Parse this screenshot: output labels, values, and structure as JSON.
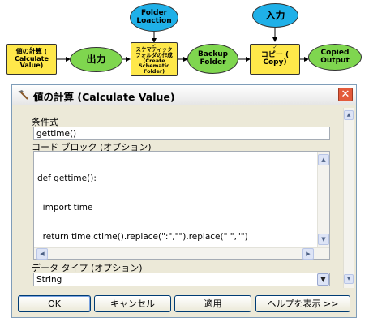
{
  "model": {
    "nodes": {
      "calculate_value": "値の計算 (\nCalculate\nValue)",
      "output": "出力",
      "folder_loaction": "Folder\nLoaction",
      "create_folder": "スケマティック\nフォルダの作成\n(Create\nSchematic\nFolder)",
      "backup_folder": "Backup\nFolder",
      "input": "入力",
      "copy": "コピー (\nCopy)",
      "copied_output": "Copied\nOutput"
    }
  },
  "dialog": {
    "title": "値の計算 (Calculate Value)",
    "close_glyph": "✕",
    "expression_label": "条件式",
    "expression_value": "gettime()",
    "code_block_label": "コード ブロック (オプション)",
    "code_lines": [
      "def gettime():",
      "  import time",
      "  return time.ctime().replace(\":\",\"\").replace(\" \",\"\")"
    ],
    "data_type_label": "データ タイプ (オプション)",
    "data_type_value": "String",
    "buttons": {
      "ok": "OK",
      "cancel": "キャンセル",
      "apply": "適用",
      "help": "ヘルプを表示 >>"
    }
  },
  "colors": {
    "tool_node": "#ffe84a",
    "derived_data": "#7fd64f",
    "input_data": "#1fb0e8",
    "close_button": "#e35a3b"
  }
}
